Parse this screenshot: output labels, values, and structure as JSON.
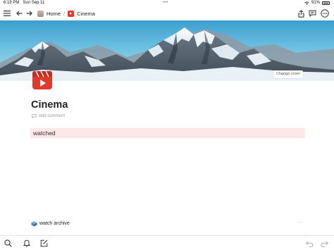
{
  "status_bar": {
    "time": "6:19 PM",
    "date": "Sun Sep 11",
    "dots": "•••",
    "battery_percent": "91%"
  },
  "toolbar": {
    "breadcrumbs": [
      {
        "label": "Home",
        "icon": "home-page-icon"
      },
      {
        "label": "Cinema",
        "icon": "cinema-page-icon"
      }
    ],
    "separator": "/"
  },
  "cover": {
    "change_cover_label": "Change cover"
  },
  "page": {
    "title": "Cinema",
    "add_comment_label": "Add comment",
    "callout_text": "watched",
    "link_label": "watch archive",
    "link_more": "···"
  },
  "colors": {
    "callout_bg": "#fde8e8",
    "page_icon": "#e03a2e",
    "sky": "#4aa8d8"
  }
}
